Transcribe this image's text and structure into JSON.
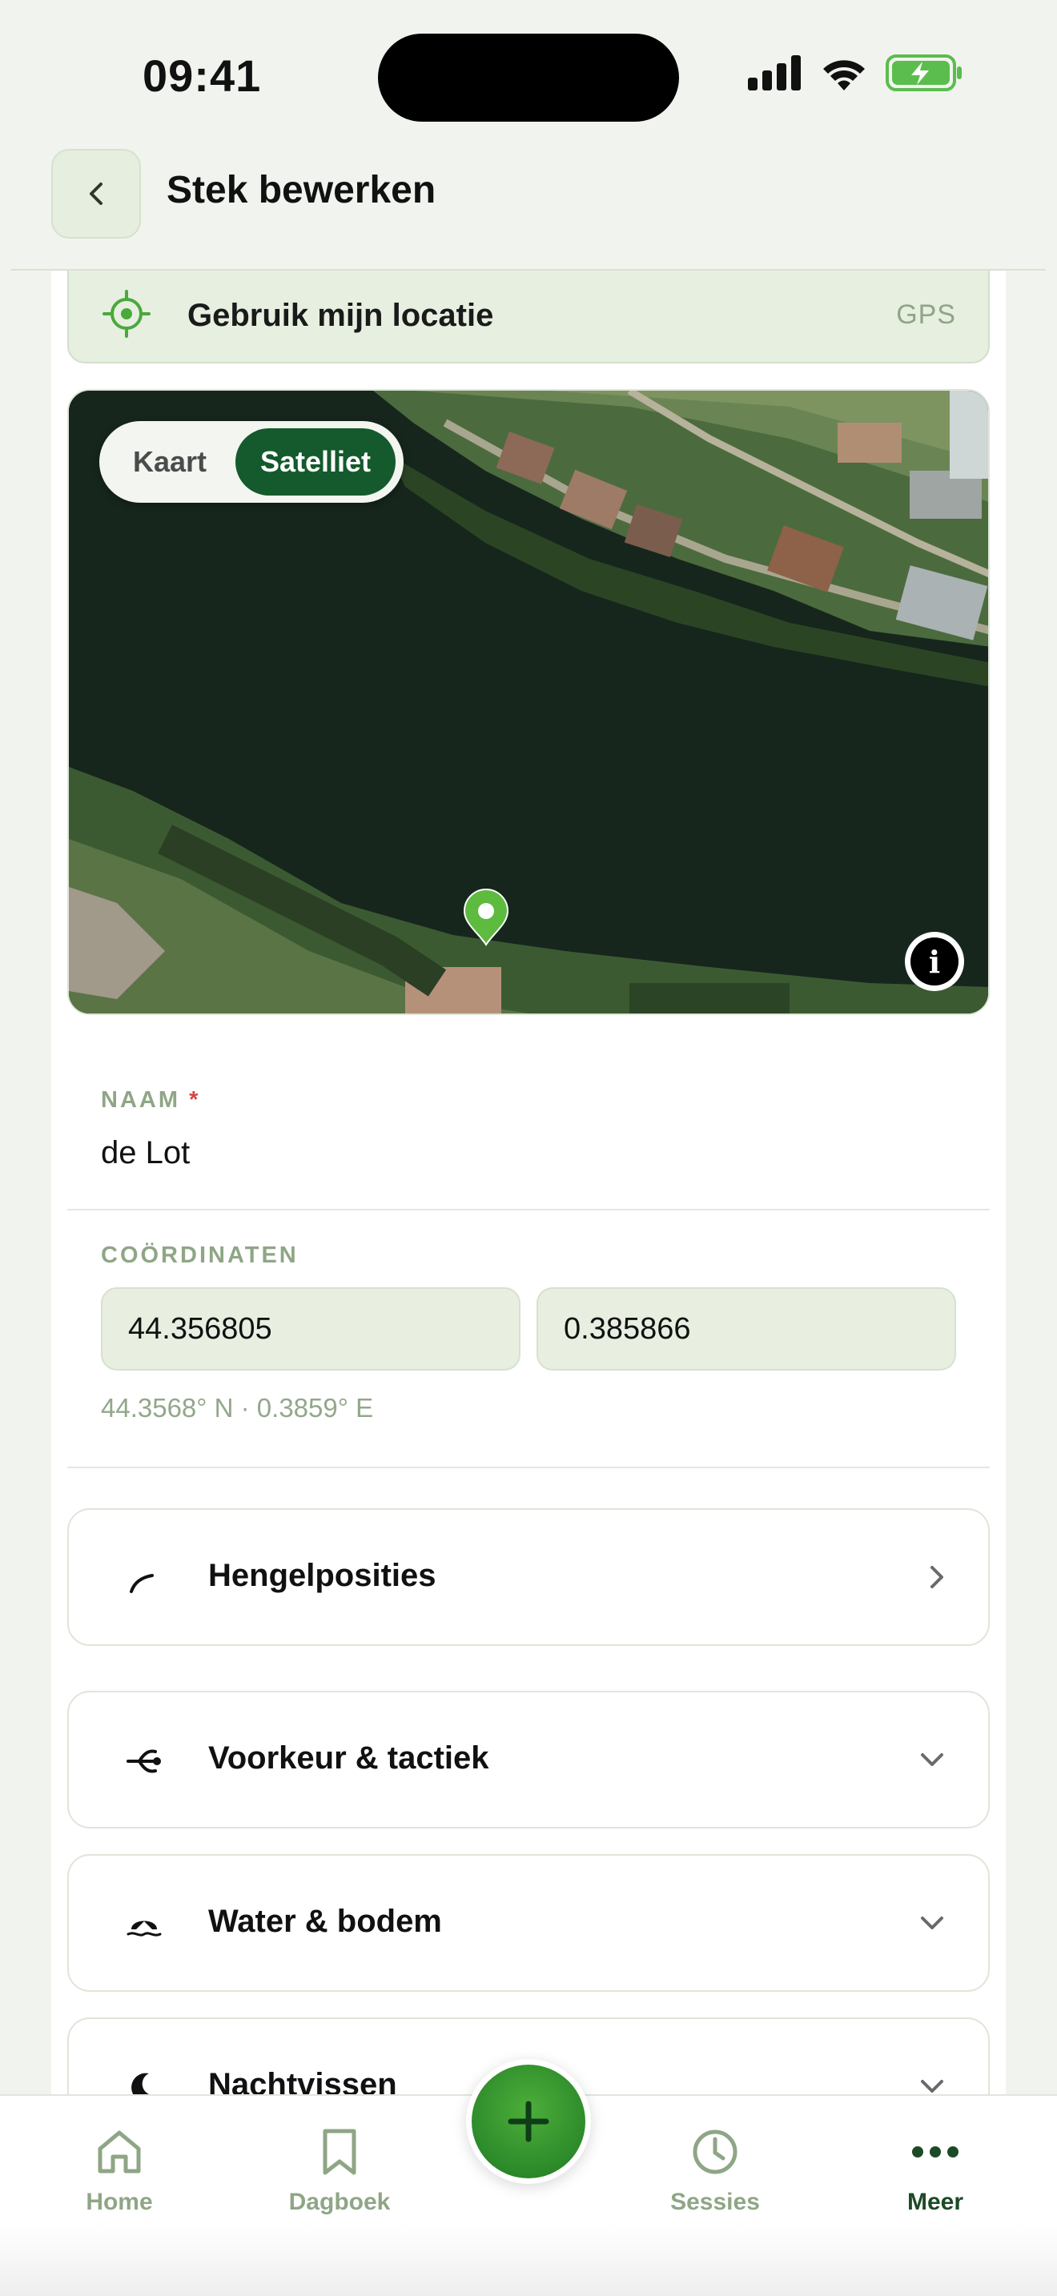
{
  "status_bar": {
    "time": "09:41"
  },
  "header": {
    "title": "Stek bewerken",
    "back_icon": "chevron-left-icon"
  },
  "gps": {
    "label": "Gebruik mijn locatie",
    "tag": "GPS"
  },
  "map": {
    "toggle": {
      "kaart": "Kaart",
      "satelliet": "Satelliet",
      "selected": "Satelliet"
    }
  },
  "form": {
    "name_label": "NAAM",
    "name_required": "*",
    "name_value": "de Lot",
    "coords_label": "COÖRDINATEN",
    "lat": "44.356805",
    "lon": "0.385866",
    "coords_hint": "44.3568° N · 0.3859° E"
  },
  "sections": [
    {
      "label": "Hengelposities",
      "icon": "rod-icon",
      "chevron": "right"
    },
    {
      "label": "Voorkeur & tactiek",
      "icon": "wind-icon",
      "chevron": "down"
    },
    {
      "label": "Water & bodem",
      "icon": "water-icon",
      "chevron": "down"
    },
    {
      "label": "Nachtvissen",
      "icon": "moon-icon",
      "chevron": "down"
    }
  ],
  "nav": {
    "home": "Home",
    "dagboek": "Dagboek",
    "sessies": "Sessies",
    "meer": "Meer",
    "active": "Meer"
  },
  "colors": {
    "accent": "#145a2c",
    "brand_green": "#2d8a2a",
    "muted": "#8fa686"
  }
}
